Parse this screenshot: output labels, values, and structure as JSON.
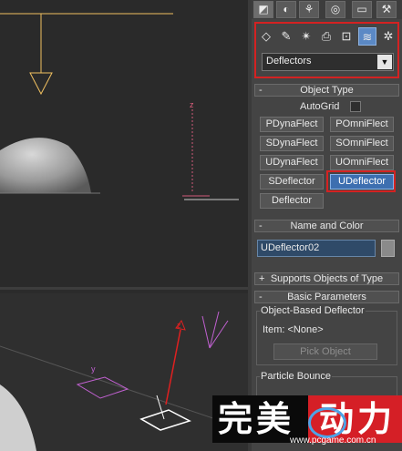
{
  "command_panel": {
    "tabs": [
      {
        "icon": "create-icon",
        "glyph": "◩"
      },
      {
        "icon": "modify-icon",
        "glyph": "◐"
      },
      {
        "icon": "hierarchy-icon",
        "glyph": "⚘"
      },
      {
        "icon": "motion-icon",
        "glyph": "◎"
      },
      {
        "icon": "display-icon",
        "glyph": "▭"
      },
      {
        "icon": "utilities-icon",
        "glyph": "⚒"
      }
    ],
    "categories": [
      {
        "icon": "geometry-icon",
        "glyph": "◇"
      },
      {
        "icon": "shapes-icon",
        "glyph": "✎"
      },
      {
        "icon": "lights-icon",
        "glyph": "✴"
      },
      {
        "icon": "cameras-icon",
        "glyph": "⎙"
      },
      {
        "icon": "helpers-icon",
        "glyph": "⊡"
      },
      {
        "icon": "space-warps-icon",
        "glyph": "≋"
      },
      {
        "icon": "systems-icon",
        "glyph": "✲"
      }
    ],
    "category_dropdown": "Deflectors"
  },
  "object_type": {
    "title": "Object Type",
    "toggle": "-",
    "autogrid_label": "AutoGrid",
    "buttons": [
      "PDynaFlect",
      "POmniFlect",
      "SDynaFlect",
      "SOmniFlect",
      "UDynaFlect",
      "UOmniFlect",
      "SDeflector",
      "UDeflector",
      "Deflector"
    ],
    "active_button": "UDeflector"
  },
  "name_and_color": {
    "title": "Name and Color",
    "toggle": "-",
    "name_value": "UDeflector02"
  },
  "supports_objects": {
    "title": "Supports Objects of Type",
    "toggle": "+"
  },
  "basic_parameters": {
    "title": "Basic Parameters",
    "toggle": "-",
    "group_label": "Object-Based Deflector",
    "item_label": "Item: <None>",
    "pick_button": "Pick Object",
    "particle_bounce_label": "Particle Bounce"
  },
  "viewport_top": {
    "axis_label": "z"
  },
  "viewport_bottom": {
    "axis_label_z": "z",
    "axis_label_y": "y"
  },
  "watermark": {
    "left_text": "完美",
    "right_text": "动力",
    "url": "www.pcgame.com.cn"
  }
}
